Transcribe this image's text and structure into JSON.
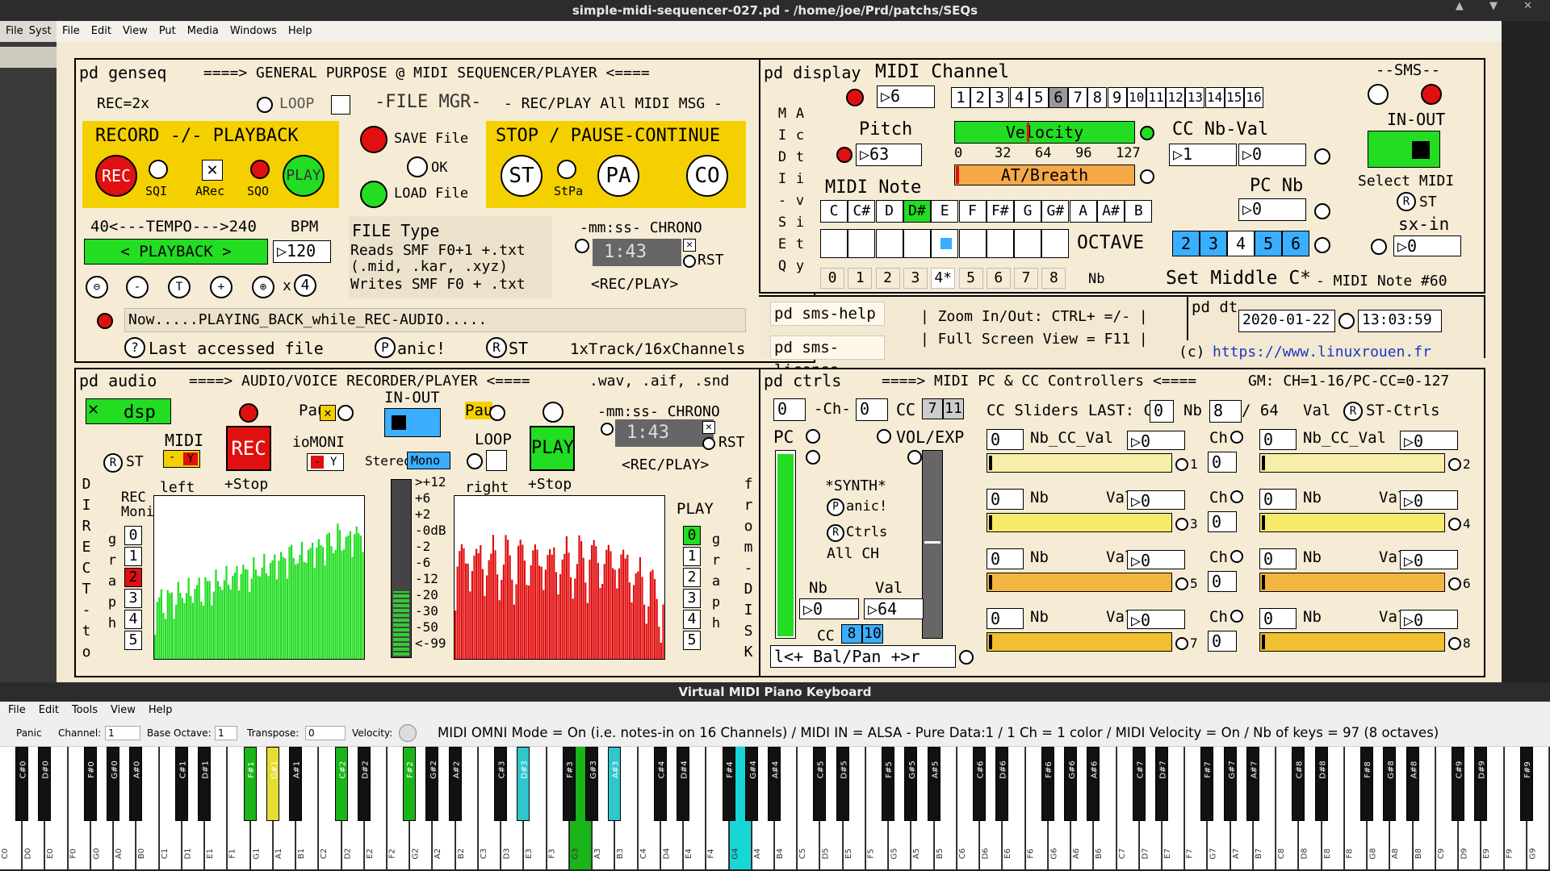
{
  "window": {
    "title": "simple-midi-sequencer-027.pd  - /home/joe/Prd/patchs/SEQs"
  },
  "left_menu": [
    "File",
    "Syst"
  ],
  "pd_menu": [
    "File",
    "Edit",
    "View",
    "Put",
    "Media",
    "Windows",
    "Help"
  ],
  "genseq": {
    "title": "pd genseq",
    "header": "====> GENERAL PURPOSE @ MIDI SEQUENCER/PLAYER <====",
    "rec2x": "REC=2x",
    "loop": "LOOP",
    "filemgr": "-FILE MGR-",
    "recplay_all": "- REC/PLAY All MIDI MSG -",
    "record_playback": "RECORD -/- PLAYBACK",
    "rec": "REC",
    "play": "PLAY",
    "sqi": "SQI",
    "arec": "ARec",
    "sqo": "SQO",
    "save_file": "SAVE File",
    "ok": "OK",
    "load_file": "LOAD File",
    "stop_pause": "STOP / PAUSE-CONTINUE",
    "st": "ST",
    "stpa": "StPa",
    "pa": "PA",
    "co": "CO",
    "tempo": "40<---TEMPO--->240",
    "bpm": "BPM",
    "bpm_val": "120",
    "playback": "< PLAYBACK >",
    "x4": "x",
    "x4v": "4",
    "filetype": "FILE Type",
    "reads1": "Reads SMF F0+1 +.txt",
    "reads2": " (.mid, .kar, .xyz)",
    "writes": "Writes SMF F0 + .txt",
    "chrono": "-mm:ss- CHRONO",
    "chrono_val": "1:43",
    "rst": "RST",
    "recplay": "<REC/PLAY>",
    "status": "Now.....PLAYING_BACK_while_REC-AUDIO.....",
    "last_file": "Last accessed file",
    "panic": "anic!",
    "st2": "ST",
    "tracks": "1xTrack/16xChannels"
  },
  "display": {
    "title": "pd display",
    "midi_channel": "MIDI Channel",
    "ch_val": "6",
    "channels": [
      "1",
      "2",
      "3",
      "4",
      "5",
      "6",
      "7",
      "8",
      "9",
      "10",
      "11",
      "12",
      "13",
      "14",
      "15",
      "16"
    ],
    "sms": "--SMS--",
    "inout": "IN-OUT",
    "select_midi": "Select MIDI",
    "st": "ST",
    "sxin": "sx-in",
    "sxin_val": "0",
    "side1": [
      "M",
      "I",
      "D",
      "I",
      "-",
      "S",
      "E",
      "Q"
    ],
    "side2": [
      "A",
      "c",
      "t",
      "i",
      "v",
      "i",
      "t",
      "y"
    ],
    "pitch": "Pitch",
    "pitch_val": "63",
    "velocity": "Velocity",
    "vel_ticks": [
      "0",
      "32",
      "64",
      "96",
      "127"
    ],
    "at_breath": "AT/Breath",
    "cc_nbval": "CC Nb-Val",
    "cc_nb": "1",
    "cc_val": "0",
    "pc_nb": "PC Nb",
    "pc_val": "0",
    "midi_note": "MIDI Note",
    "notes": [
      "C",
      "C#",
      "D",
      "D#",
      "E",
      "F",
      "F#",
      "G",
      "G#",
      "A",
      "A#",
      "B"
    ],
    "octave": "OCTAVE",
    "oct_btns": [
      "2",
      "3",
      "4",
      "5",
      "6"
    ],
    "oct_nums": [
      "0",
      "1",
      "2",
      "3",
      "4*",
      "5",
      "6",
      "7",
      "8"
    ],
    "nb": "Nb",
    "set_middle": "Set Middle C*",
    "middle_note": "- MIDI Note #60",
    "sms_help": "pd sms-help",
    "sms_license": "pd sms-license",
    "zoom": "| Zoom In/Out: CTRL+ =/- |",
    "fullscreen": "| Full Screen View = F11 |",
    "dt": "pd dt",
    "date": "2020-01-22",
    "time": "13:03:59",
    "copyright": "(c)",
    "url": "https://www.linuxrouen.fr"
  },
  "audio": {
    "title": "pd audio",
    "header": "====> AUDIO/VOICE RECORDER/PLAYER <====",
    "formats": ".wav, .aif, .snd",
    "dsp": "dsp",
    "midi": "MIDI",
    "rec": "REC",
    "stop": "+Stop",
    "left": "left",
    "right": "right",
    "st": "ST",
    "pau": "Pau",
    "inout": "IN-OUT",
    "iomoni": "ioMONI",
    "y": "Y",
    "stereo": "Stereo",
    "mono": "Mono",
    "loop": "LOOP",
    "play": "PLAY",
    "chrono": "-mm:ss- CHRONO",
    "chrono_val": "1:43",
    "rst": "RST",
    "recplay": "<REC/PLAY>",
    "db_scale": [
      ">+12",
      "+6",
      "+2",
      "-0dB",
      "-2",
      "-6",
      "-12",
      "-20",
      "-30",
      "-50",
      "<-99"
    ],
    "rec_moni": "REC Moni",
    "moni_nums": [
      "0",
      "1",
      "2",
      "3",
      "4",
      "5"
    ],
    "play_label": "PLAY",
    "play_nums": [
      "0",
      "1",
      "2",
      "3",
      "4",
      "5"
    ],
    "direct_to": [
      "D",
      "I",
      "R",
      "E",
      "C",
      "T",
      "-",
      "t",
      "o"
    ],
    "graph": [
      "g",
      "r",
      "a",
      "p",
      "h"
    ],
    "from_disk": [
      "f",
      "r",
      "o",
      "m",
      "-",
      "D",
      "I",
      "S",
      "K"
    ]
  },
  "ctrls": {
    "title": "pd ctrls",
    "header": "====> MIDI PC & CC Controllers <====",
    "gm": "GM: CH=1-16/PC-CC=0-127",
    "ch0": "0",
    "ch_lbl": "-Ch-",
    "ch1": "0",
    "cc": "CC",
    "cc_tabs": [
      "7",
      "11"
    ],
    "sliders_last": "CC Sliders LAST: Ch",
    "last_ch": "0",
    "nb": "Nb",
    "last_nb": "8",
    "of64": "/ 64",
    "val": "Val",
    "st_ctrls": "ST-Ctrls",
    "pc": "PC",
    "vol_exp": "VOL/EXP",
    "synth": "*SYNTH*",
    "panic": "anic!",
    "ctrls": "Ctrls",
    "all_ch": "All CH",
    "nb_lbl": "Nb",
    "nb_val": "0",
    "val_lbl": "Val",
    "val_val": "64",
    "cc2": "CC",
    "cc2_tabs": [
      "8",
      "10"
    ],
    "balpan": "l<+ Bal/Pan +>r",
    "rows": [
      {
        "a_num": "0",
        "a_lbl": "Nb_CC_Val",
        "a_val": "0",
        "a_idx": "1",
        "ch": "0",
        "b_num": "0",
        "b_lbl": "Nb_CC_Val",
        "b_val": "0",
        "b_idx": "2"
      },
      {
        "a_num": "0",
        "a_lbl": "Nb",
        "a_val": "0",
        "a_idx": "3",
        "ch": "0",
        "b_num": "0",
        "b_lbl": "Nb",
        "b_val": "0",
        "b_idx": "4"
      },
      {
        "a_num": "0",
        "a_lbl": "Nb",
        "a_val": "0",
        "a_idx": "5",
        "ch": "0",
        "b_num": "0",
        "b_lbl": "Nb",
        "b_val": "0",
        "b_idx": "6"
      },
      {
        "a_num": "0",
        "a_lbl": "Nb",
        "a_val": "0",
        "a_idx": "7",
        "ch": "0",
        "b_num": "0",
        "b_lbl": "Nb",
        "b_val": "0",
        "b_idx": "8"
      }
    ],
    "ch_lbl2": "Ch",
    "val_lbl2": "Val"
  },
  "vmpk": {
    "title": "Virtual MIDI Piano Keyboard",
    "menu": [
      "File",
      "Edit",
      "Tools",
      "View",
      "Help"
    ],
    "panic": "Panic",
    "channel": "Channel:",
    "channel_val": "1",
    "base_octave": "Base Octave:",
    "base_octave_val": "1",
    "transpose": "Transpose:",
    "transpose_val": "0",
    "velocity": "Velocity:",
    "status": "MIDI OMNI Mode = On (i.e. notes-in on 16 Channels) / MIDI IN = ALSA - Pure Data:1 / 1 Ch = 1 color / MIDI Velocity = On / Nb of keys = 97 (8 octaves)"
  }
}
